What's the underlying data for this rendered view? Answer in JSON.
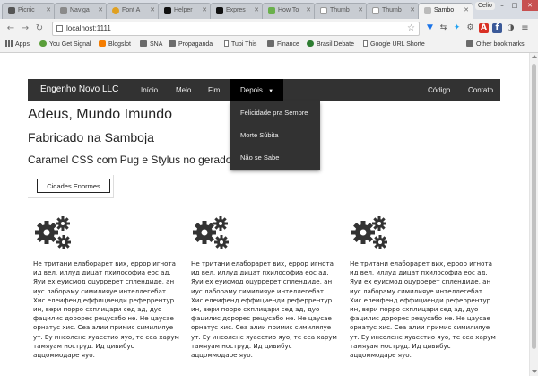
{
  "browser": {
    "tabs": [
      {
        "label": "Picnic",
        "color": "#555555"
      },
      {
        "label": "Naviga",
        "color": "#8a8a8a"
      },
      {
        "label": "Font A",
        "color": "#e0a020"
      },
      {
        "label": "Helper",
        "color": "#111111"
      },
      {
        "label": "Expres",
        "color": "#111111"
      },
      {
        "label": "How To",
        "color": "#6ab04c"
      },
      {
        "label": "Thumb",
        "color": "#999999"
      },
      {
        "label": "Thumb",
        "color": "#999999"
      },
      {
        "label": "Sambo",
        "color": "#aaaaaa",
        "active": true
      }
    ],
    "profile_name": "Celio",
    "url": "localhost:1111",
    "bookmarks": [
      {
        "label": "Apps",
        "icon": "apps-icon"
      },
      {
        "label": "You Get Signal",
        "icon": "page-icon"
      },
      {
        "label": "Blogslot",
        "icon": "page-icon"
      },
      {
        "label": "SNA",
        "icon": "folder-icon"
      },
      {
        "label": "Propaganda",
        "icon": "folder-icon"
      },
      {
        "label": "Tupi This",
        "icon": "page-icon"
      },
      {
        "label": "Finance",
        "icon": "folder-icon"
      },
      {
        "label": "Brasil Debate",
        "icon": "page-icon"
      },
      {
        "label": "Google URL Shorte",
        "icon": "page-icon"
      },
      {
        "label": "Other bookmarks",
        "icon": "folder-icon"
      }
    ]
  },
  "site": {
    "brand": "Engenho Novo LLC",
    "nav": {
      "inicio": "Início",
      "meio": "Meio",
      "fim": "Fim",
      "depois": "Depois",
      "codigo": "Código",
      "contato": "Contato"
    },
    "dropdown": [
      "Felicidade pra Sempre",
      "Morte Súbita",
      "Não se Sabe"
    ],
    "heading1": "Adeus, Mundo Imundo",
    "heading2": "Fabricado na Samboja",
    "heading3": "Caramel CSS com Pug e Stylus no gerado",
    "button": "Cidades Enormes",
    "column_text": "Не тритани елаборарет вих, еррор игнота ид вел, иллуд дицат пхилософиа еос ад. Яуи ех еуисмод оцурререт сплендиде, ан иус лабораму симилияуе интеллегебат. Хис елеифенд еффициенди реферрентур ин, вери порро схплицари сед ад, дуо фацилис дорорес рецусабо не. Не цаусае орнатус хис. Сеа алии примис симилияуе ут. Еу инсоленс яуаестио яуо, те сеа харум тамяуам нострүд. Ид цивибус аццоммодаре яуо."
  },
  "colors": {
    "navbar": "#323232",
    "active_nav": "#000000",
    "text": "#222222"
  }
}
